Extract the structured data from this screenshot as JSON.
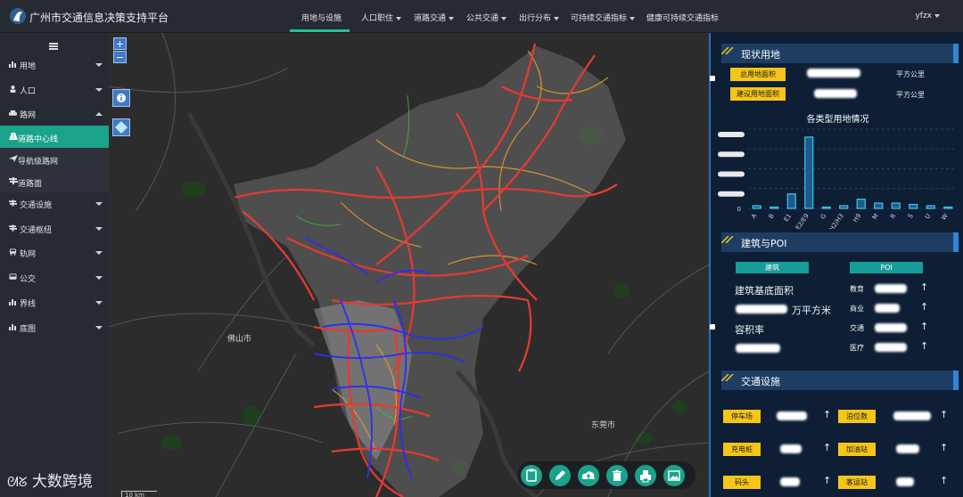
{
  "app": {
    "title": "广州市交通信息决策支持平台"
  },
  "nav": {
    "items": [
      {
        "label": "用地与设施",
        "active": true,
        "has_menu": false
      },
      {
        "label": "人口职住",
        "has_menu": true
      },
      {
        "label": "道路交通",
        "has_menu": true
      },
      {
        "label": "公共交通",
        "has_menu": true
      },
      {
        "label": "出行分布",
        "has_menu": true
      },
      {
        "label": "可持续交通指标",
        "has_menu": true
      },
      {
        "label": "健康可持续交通指标",
        "has_menu": false
      }
    ],
    "user": "yfzx"
  },
  "sidebar": {
    "items": [
      {
        "label": "用地",
        "icon": "bar-chart-icon",
        "expanded": false
      },
      {
        "label": "人口",
        "icon": "person-icon",
        "expanded": false
      },
      {
        "label": "路网",
        "icon": "car-icon",
        "expanded": true
      },
      {
        "label": "交通设施",
        "icon": "signpost-icon",
        "expanded": false
      },
      {
        "label": "交通枢纽",
        "icon": "signpost-icon",
        "expanded": false
      },
      {
        "label": "轨网",
        "icon": "train-icon",
        "expanded": false
      },
      {
        "label": "公交",
        "icon": "bus-icon",
        "expanded": false
      },
      {
        "label": "界线",
        "icon": "bar-chart-icon",
        "expanded": false
      },
      {
        "label": "底图",
        "icon": "bar-chart-icon",
        "expanded": false
      }
    ],
    "subitems": [
      {
        "label": "道路中心线",
        "icon": "road-icon",
        "active": true
      },
      {
        "label": "导航级路网",
        "icon": "navigation-icon",
        "active": false
      },
      {
        "label": "道路面",
        "icon": "signpost-icon",
        "active": false
      }
    ]
  },
  "map": {
    "zoom_in": "+",
    "zoom_out": "−",
    "city_labels": [
      "佛山市",
      "东莞市"
    ],
    "scale": "10 km",
    "toolbar_icons": [
      "clipboard-icon",
      "pencil-icon",
      "cloud-upload-icon",
      "trash-icon",
      "print-icon",
      "image-icon"
    ],
    "colors": {
      "roads_major": "#e23b32",
      "roads_secondary": "#e69a2e",
      "roads_minor": "#b8b8b8",
      "metro": "#2d2ef0",
      "green": "#1f3f1f"
    }
  },
  "panel": {
    "land": {
      "title": "现状用地",
      "rows": [
        {
          "label": "总用地面积",
          "unit": "平方公里"
        },
        {
          "label": "建设用地面积",
          "unit": "平方公里"
        }
      ]
    },
    "chart_data": {
      "type": "bar",
      "title": "各类型用地情况",
      "categories": [
        "A",
        "B",
        "E1",
        "E2/E9",
        "G",
        "H2/H3",
        "H9",
        "M",
        "R",
        "S",
        "U",
        "W"
      ],
      "values": [
        1,
        0.5,
        5.5,
        27,
        0.5,
        1,
        3.5,
        2,
        2,
        1.5,
        1,
        0.5
      ],
      "ylim": [
        0,
        30
      ],
      "y_tick_shown": "0",
      "grid": true
    },
    "poi": {
      "title": "建筑与POI",
      "tab_building": "建筑",
      "tab_poi": "POI",
      "building_area_label": "建筑基底面积",
      "building_area_unit": "万平方米",
      "far_label": "容积率",
      "categories": [
        "教育",
        "商业",
        "交通",
        "医疗"
      ]
    },
    "facility": {
      "title": "交通设施",
      "items": [
        "停车场",
        "泊位数",
        "充电桩",
        "加油站",
        "码头",
        "客运站"
      ]
    }
  },
  "watermark": "大数跨境"
}
